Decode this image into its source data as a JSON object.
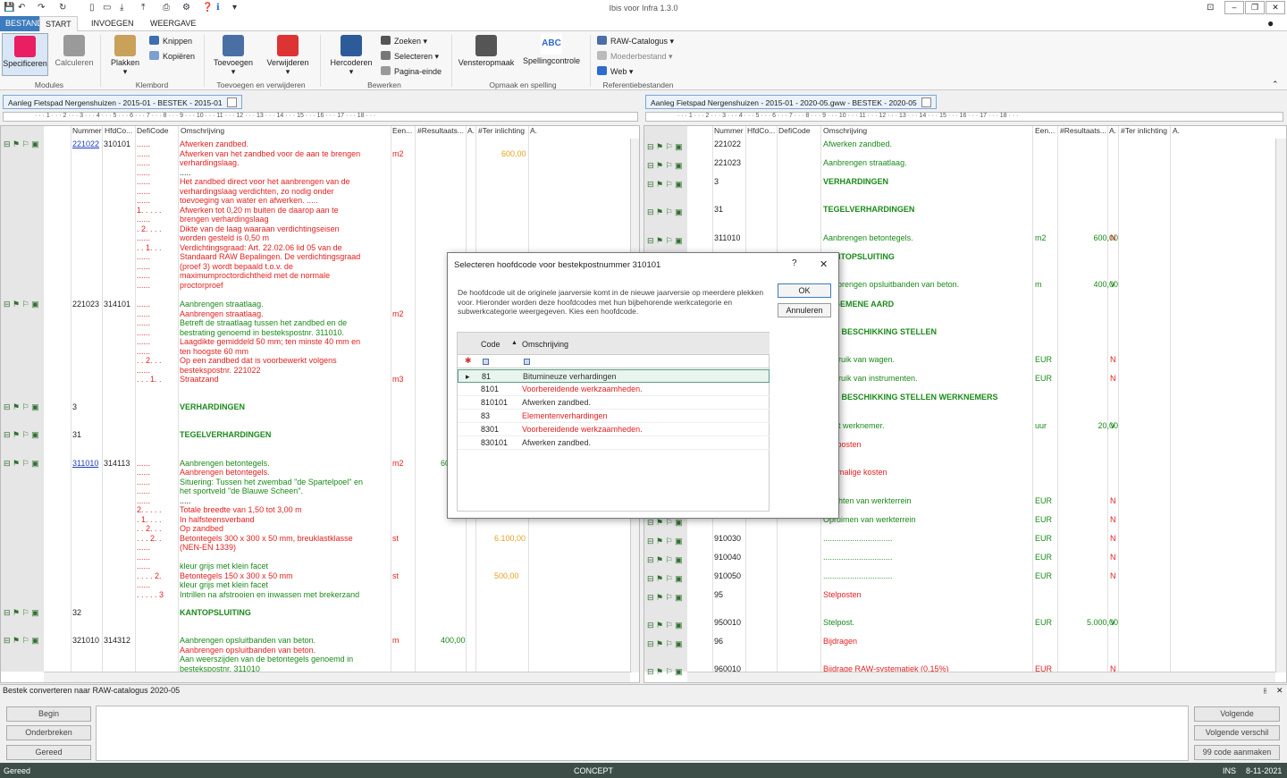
{
  "app": {
    "title": "Ibis voor Infra 1.3.0"
  },
  "menu": {
    "tabs": [
      "BESTAND",
      "START",
      "INVOEGEN",
      "WEERGAVE"
    ]
  },
  "ribbon": {
    "buttons": [
      {
        "label": "Specificeren",
        "color": "#c2185b"
      },
      {
        "label": "Calculeren",
        "color": "#888888"
      },
      {
        "label": "Plakken",
        "color": "#c9a15a"
      },
      {
        "label": "Toevoegen",
        "color": "#4a6fa5"
      },
      {
        "label": "Verwijderen",
        "color": "#d33"
      },
      {
        "label": "Hercoderen",
        "color": "#2d5b9a"
      },
      {
        "label": "Vensteropmaak",
        "color": "#555555"
      },
      {
        "label": "Spellingcontrole",
        "color": "#2e6ad0"
      }
    ],
    "small": [
      "Knippen",
      "Kopiëren",
      "Zoeken",
      "Selecteren",
      "Pagina-einde",
      "RAW-Catalogus",
      "Moederbestand",
      "Web"
    ],
    "groups": [
      "Modules",
      "Klembord",
      "Toevoegen en verwijderen",
      "Bewerken",
      "Opmaak en spelling",
      "Referentiebestanden"
    ],
    "abc_glyph": "ABC"
  },
  "doc_tabs": [
    "Aanleg Fietspad Nergenshuizen - 2015-01 - BESTEK - 2015-01",
    "Aanleg Fietspad Nergenshuizen - 2015-01 - 2020-05.gww - BESTEK - 2020-05"
  ],
  "columns": [
    "Nummer",
    "HfdCo...",
    "DefiCode",
    "Omschrijving",
    "Een...",
    "#Resultaats...",
    "A.",
    "#Ter inlichting",
    "A."
  ],
  "left_rows": [
    {
      "n": "221022",
      "h": "310101",
      "d": "......",
      "o": "Afwerken zandbed.",
      "u": "",
      "r": "",
      "t": "",
      "nc": "lnk",
      "oc": "red"
    },
    {
      "n": "",
      "h": "",
      "d": "......",
      "o": "Afwerken van het zandbed voor de aan te brengen",
      "u": "m2",
      "r": "",
      "t": "600,00",
      "nc": "",
      "oc": "red"
    },
    {
      "n": "",
      "h": "",
      "d": "......",
      "o": "verhardingslaag.",
      "u": "",
      "r": "",
      "t": "",
      "nc": "",
      "oc": "red"
    },
    {
      "n": "",
      "h": "",
      "d": "......",
      "o": ".....",
      "u": "",
      "r": "",
      "t": "",
      "nc": "",
      "oc": "blk"
    },
    {
      "n": "",
      "h": "",
      "d": "......",
      "o": "Het zandbed direct voor het aanbrengen van de",
      "u": "",
      "r": "",
      "t": "",
      "nc": "",
      "oc": "red"
    },
    {
      "n": "",
      "h": "",
      "d": "......",
      "o": "verhardingslaag verdichten, zo nodig onder",
      "u": "",
      "r": "",
      "t": "",
      "nc": "",
      "oc": "red"
    },
    {
      "n": "",
      "h": "",
      "d": "......",
      "o": "toevoeging van water en afwerken. .....",
      "u": "",
      "r": "",
      "t": "",
      "nc": "",
      "oc": "red"
    },
    {
      "n": "",
      "h": "",
      "d": "1. . . . .",
      "o": "Afwerken tot 0,20 m buiten de daarop aan te",
      "u": "",
      "r": "",
      "t": "",
      "nc": "",
      "oc": "red"
    },
    {
      "n": "",
      "h": "",
      "d": "......",
      "o": "brengen verhardingslaag",
      "u": "",
      "r": "",
      "t": "",
      "nc": "",
      "oc": "red"
    },
    {
      "n": "",
      "h": "",
      "d": ". 2. . . .",
      "o": "Dikte van de laag waaraan verdichtingseisen",
      "u": "",
      "r": "",
      "t": "",
      "nc": "",
      "oc": "red"
    },
    {
      "n": "",
      "h": "",
      "d": "......",
      "o": "worden gesteld is 0,50 m",
      "u": "",
      "r": "",
      "t": "",
      "nc": "",
      "oc": "red"
    },
    {
      "n": "",
      "h": "",
      "d": ". . 1. . .",
      "o": "Verdichtingsgraad: Art. 22.02.06 lid 05 van de",
      "u": "",
      "r": "",
      "t": "",
      "nc": "",
      "oc": "red"
    },
    {
      "n": "",
      "h": "",
      "d": "......",
      "o": "Standaard RAW Bepalingen. De verdichtingsgraad",
      "u": "",
      "r": "",
      "t": "",
      "nc": "",
      "oc": "red"
    },
    {
      "n": "",
      "h": "",
      "d": "......",
      "o": "(proef 3) wordt bepaald t.o.v. de",
      "u": "",
      "r": "",
      "t": "",
      "nc": "",
      "oc": "red"
    },
    {
      "n": "",
      "h": "",
      "d": "......",
      "o": "maximumproctordichtheid met de normale",
      "u": "",
      "r": "",
      "t": "",
      "nc": "",
      "oc": "red"
    },
    {
      "n": "",
      "h": "",
      "d": "......",
      "o": "proctorproef",
      "u": "",
      "r": "",
      "t": "",
      "nc": "",
      "oc": "red"
    },
    {
      "n": "221023",
      "h": "314101",
      "d": "......",
      "o": "Aanbrengen straatlaag.",
      "u": "",
      "r": "",
      "t": "",
      "nc": "blk",
      "oc": "grn"
    },
    {
      "n": "",
      "h": "",
      "d": "......",
      "o": "Aanbrengen straatlaag.",
      "u": "m2",
      "r": "",
      "t": "",
      "nc": "",
      "oc": "red"
    },
    {
      "n": "",
      "h": "",
      "d": "......",
      "o": "Betreft de straatlaag tussen het zandbed en de",
      "u": "",
      "r": "",
      "t": "",
      "nc": "",
      "oc": "grn"
    },
    {
      "n": "",
      "h": "",
      "d": "......",
      "o": "bestrating genoemd in bestekspostnr. 311010.",
      "u": "",
      "r": "",
      "t": "",
      "nc": "",
      "oc": "grn"
    },
    {
      "n": "",
      "h": "",
      "d": "......",
      "o": "Laagdikte gemiddeld 50 mm; ten minste 40 mm en",
      "u": "",
      "r": "",
      "t": "",
      "nc": "",
      "oc": "red"
    },
    {
      "n": "",
      "h": "",
      "d": "......",
      "o": "ten hoogste 60 mm",
      "u": "",
      "r": "",
      "t": "",
      "nc": "",
      "oc": "red"
    },
    {
      "n": "",
      "h": "",
      "d": ". . 2. . .",
      "o": "Op een zandbed dat is voorbewerkt volgens",
      "u": "",
      "r": "",
      "t": "",
      "nc": "",
      "oc": "red"
    },
    {
      "n": "",
      "h": "",
      "d": "......",
      "o": "bestekspostnr. 221022",
      "u": "",
      "r": "",
      "t": "",
      "nc": "",
      "oc": "red"
    },
    {
      "n": "",
      "h": "",
      "d": ". . . 1. .",
      "o": "Straatzand",
      "u": "m3",
      "r": "",
      "t": "",
      "nc": "",
      "oc": "red"
    }
  ],
  "left_rows_b": [
    {
      "n": "3",
      "o": "VERHARDINGEN"
    },
    {
      "n": "31",
      "o": "TEGELVERHARDINGEN"
    }
  ],
  "left_rows_c": [
    {
      "n": "311010",
      "h": "314113",
      "d": "......",
      "o": "Aanbrengen betontegels.",
      "u": "m2",
      "r": "60",
      "t": "",
      "nc": "lnk",
      "oc": "grn"
    },
    {
      "n": "",
      "h": "",
      "d": "......",
      "o": "Aanbrengen betontegels.",
      "u": "",
      "r": "",
      "t": "",
      "nc": "",
      "oc": "red"
    },
    {
      "n": "",
      "h": "",
      "d": "......",
      "o": "Situering: Tussen het zwembad \"de Spartelpoel\" en",
      "u": "",
      "r": "",
      "t": "",
      "nc": "",
      "oc": "grn"
    },
    {
      "n": "",
      "h": "",
      "d": "......",
      "o": "het sportveld \"de Blauwe Scheen\".",
      "u": "",
      "r": "",
      "t": "",
      "nc": "",
      "oc": "grn"
    },
    {
      "n": "",
      "h": "",
      "d": "......",
      "o": ".....",
      "u": "",
      "r": "",
      "t": "",
      "nc": "",
      "oc": "blk"
    },
    {
      "n": "",
      "h": "",
      "d": "2. . . . .",
      "o": "Totale breedte van 1,50 tot 3,00 m",
      "u": "",
      "r": "",
      "t": "",
      "nc": "",
      "oc": "red"
    },
    {
      "n": "",
      "h": "",
      "d": ". 1. . . .",
      "o": "In halfsteensverband",
      "u": "",
      "r": "",
      "t": "",
      "nc": "",
      "oc": "red"
    },
    {
      "n": "",
      "h": "",
      "d": ". . 2. . .",
      "o": "Op zandbed",
      "u": "",
      "r": "",
      "t": "",
      "nc": "",
      "oc": "red"
    },
    {
      "n": "",
      "h": "",
      "d": ". . . 2. .",
      "o": "Betontegels 300 x 300 x 50 mm, breuklastklasse",
      "u": "st",
      "r": "",
      "t": "6.100,00",
      "nc": "",
      "oc": "red"
    },
    {
      "n": "",
      "h": "",
      "d": "......",
      "o": "(NEN-EN 1339)",
      "u": "",
      "r": "",
      "t": "",
      "nc": "",
      "oc": "red"
    },
    {
      "n": "",
      "h": "",
      "d": "......",
      "o": "",
      "u": "",
      "r": "",
      "t": "",
      "nc": "",
      "oc": "red"
    },
    {
      "n": "",
      "h": "",
      "d": "......",
      "o": "kleur grijs met klein facet",
      "u": "",
      "r": "",
      "t": "",
      "nc": "",
      "oc": "grn"
    },
    {
      "n": "",
      "h": "",
      "d": ". . . . 2.",
      "o": "Betontegels 150 x 300 x 50 mm",
      "u": "st",
      "r": "",
      "t": "500,00",
      "nc": "",
      "oc": "red"
    },
    {
      "n": "",
      "h": "",
      "d": "......",
      "o": "kleur grijs met klein facet",
      "u": "",
      "r": "",
      "t": "",
      "nc": "",
      "oc": "grn"
    },
    {
      "n": "",
      "h": "",
      "d": ". . . . . 3",
      "o": "Intrillen na afstrooien en inwassen met brekerzand",
      "u": "",
      "r": "",
      "t": "",
      "nc": "",
      "oc": "grn"
    }
  ],
  "left_rows_d": [
    {
      "n": "32",
      "o": "KANTOPSLUITING"
    },
    {
      "n": "321010",
      "h": "314312",
      "o": "Aanbrengen opsluitbanden van beton.",
      "u": "m",
      "r": "400,00"
    },
    {
      "o": "Aanbrengen opsluitbanden van beton."
    },
    {
      "o": "Aan weerszijden van de betontegels genoemd in"
    },
    {
      "o": "bestekspostnr. 311010"
    }
  ],
  "right_rows": [
    {
      "n": "221022",
      "o": "Afwerken zandbed.",
      "u": "",
      "t": "",
      "a": "",
      "oc": "grn"
    },
    {
      "n": "221023",
      "o": "Aanbrengen straatlaag.",
      "u": "",
      "t": "",
      "a": "",
      "oc": "grn"
    },
    {
      "n": "3",
      "o": "VERHARDINGEN",
      "u": "",
      "t": "",
      "a": "",
      "oc": "bgrn"
    },
    {
      "n": "31",
      "o": "TEGELVERHARDINGEN",
      "u": "",
      "t": "",
      "a": "",
      "oc": "bgrn"
    },
    {
      "n": "311010",
      "o": "Aanbrengen betontegels.",
      "u": "m2",
      "t": "600,00",
      "a": "N",
      "oc": "grn"
    },
    {
      "n": "",
      "o": "KANTOPSLUITING",
      "u": "",
      "t": "",
      "a": "",
      "oc": "bgrn"
    },
    {
      "n": "",
      "o": "Aanbrengen opsluitbanden van beton.",
      "u": "m",
      "t": "400,00",
      "a": "V",
      "oc": "grn"
    },
    {
      "n": "",
      "o": "ALGEMENE AARD",
      "u": "",
      "t": "",
      "a": "",
      "oc": "bgrn"
    },
    {
      "n": "",
      "o": "TER BESCHIKKING STELLEN",
      "u": "",
      "t": "",
      "a": "",
      "oc": "bgrn"
    },
    {
      "n": "",
      "o": "Gebruik van wagen.",
      "u": "EUR",
      "t": "",
      "a": "N",
      "oc": "grn"
    },
    {
      "n": "",
      "o": "Gebruik van instrumenten.",
      "u": "EUR",
      "t": "",
      "a": "N",
      "oc": "grn"
    },
    {
      "n": "",
      "o": "TER BESCHIKKING STELLEN WERKNEMERS",
      "u": "",
      "t": "",
      "a": "",
      "oc": "bgrn"
    },
    {
      "n": "",
      "o": "Inzet werknemer.",
      "u": "uur",
      "t": "20,00",
      "a": "V",
      "oc": "grn"
    },
    {
      "n": "",
      "o": "Stelposten",
      "u": "",
      "t": "",
      "a": "",
      "oc": "red"
    },
    {
      "n": "",
      "o": "Eenmalige kosten",
      "u": "",
      "t": "",
      "a": "",
      "oc": "red"
    },
    {
      "n": "",
      "o": "Inrichten van werkterrein",
      "u": "EUR",
      "t": "",
      "a": "N",
      "oc": "grn"
    },
    {
      "n": "",
      "o": "Opruimen van werkterrein",
      "u": "EUR",
      "t": "",
      "a": "N",
      "oc": "grn"
    },
    {
      "n": "910030",
      "o": "...............................",
      "u": "EUR",
      "t": "",
      "a": "N",
      "oc": "grn"
    },
    {
      "n": "910040",
      "o": "...............................",
      "u": "EUR",
      "t": "",
      "a": "N",
      "oc": "grn"
    },
    {
      "n": "910050",
      "o": "...............................",
      "u": "EUR",
      "t": "",
      "a": "N",
      "oc": "grn"
    },
    {
      "n": "95",
      "o": "Stelposten",
      "u": "",
      "t": "",
      "a": "",
      "oc": "red"
    },
    {
      "n": "950010",
      "o": "Stelpost.",
      "u": "EUR",
      "t": "5.000,00",
      "a": "V",
      "oc": "grn"
    },
    {
      "n": "96",
      "o": "Bijdragen",
      "u": "",
      "t": "",
      "a": "",
      "oc": "red"
    },
    {
      "n": "960010",
      "o": "Bijdrage RAW-systematiek (0,15%)",
      "u": "EUR",
      "t": "",
      "a": "N",
      "oc": "red"
    }
  ],
  "dialog": {
    "title": "Selecteren hoofdcode voor bestekpostnummer 310101",
    "help": "?",
    "close": "✕",
    "message": "De hoofdcode uit de originele jaarversie komt in de nieuwe jaarversie op meerdere plekken voor. Hieronder worden deze hoofdcodes met hun bijbehorende werkcategorie en subwerkcategorie weergegeven. Kies een hoofdcode.",
    "ok": "OK",
    "cancel": "Annuleren",
    "grid_cols": [
      "Code",
      "Omschrijving"
    ],
    "rows": [
      {
        "code": "81",
        "desc": "Bitumineuze verhardingen",
        "color": "#333333"
      },
      {
        "code": "8101",
        "desc": "Voorbereidende werkzaamheden.",
        "color": "#e42020"
      },
      {
        "code": "810101",
        "desc": "Afwerken zandbed.",
        "color": "#333333"
      },
      {
        "code": "83",
        "desc": "Elementenverhardingen",
        "color": "#e42020"
      },
      {
        "code": "8301",
        "desc": "Voorbereidende werkzaamheden.",
        "color": "#e42020"
      },
      {
        "code": "830101",
        "desc": "Afwerken zandbed.",
        "color": "#333333"
      }
    ]
  },
  "bottom": {
    "title": "Bestek converteren naar RAW-catalogus 2020-05",
    "left_buttons": [
      "Begin",
      "Onderbreken",
      "Gereed"
    ],
    "right_buttons": [
      "Volgende",
      "Volgende verschil",
      "99 code aanmaken"
    ]
  },
  "status": {
    "left": "Gereed",
    "center": "CONCEPT",
    "ins": "INS",
    "date": "8-11-2021"
  }
}
